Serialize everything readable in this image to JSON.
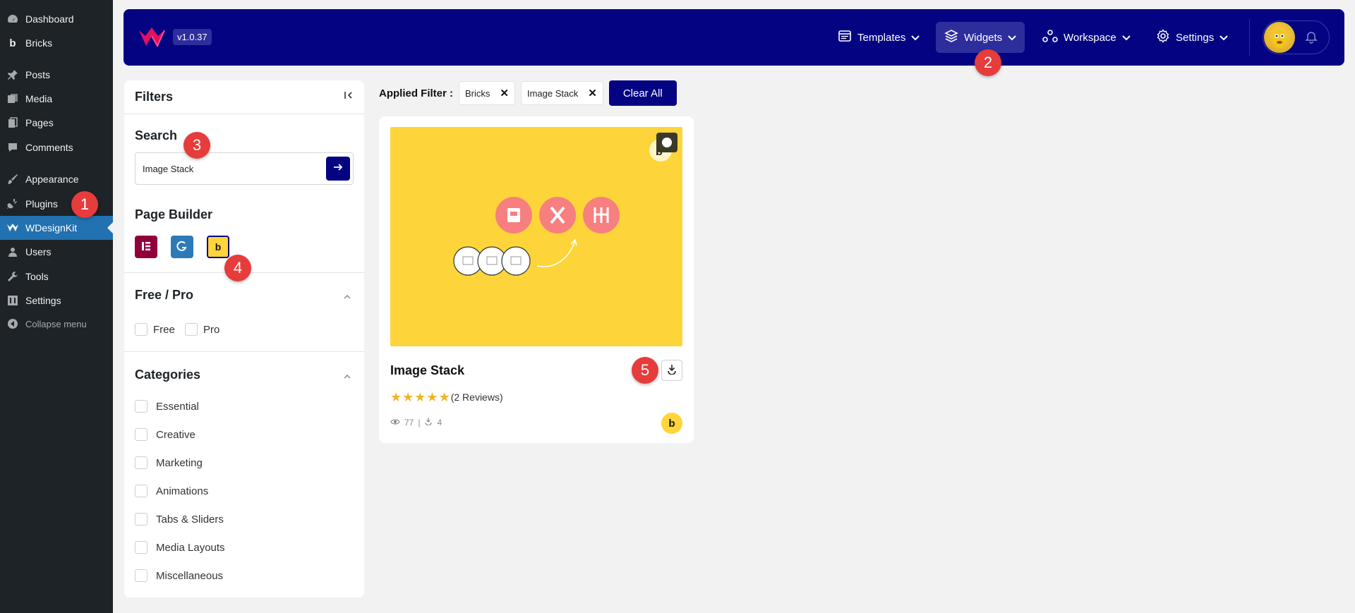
{
  "wp_menu": [
    {
      "label": "Dashboard",
      "icon": "dashboard-icon"
    },
    {
      "label": "Bricks",
      "icon": "bricks-icon"
    },
    {
      "label": "Posts",
      "icon": "pin-icon"
    },
    {
      "label": "Media",
      "icon": "media-icon"
    },
    {
      "label": "Pages",
      "icon": "pages-icon"
    },
    {
      "label": "Comments",
      "icon": "comments-icon"
    },
    {
      "label": "Appearance",
      "icon": "brush-icon"
    },
    {
      "label": "Plugins",
      "icon": "plug-icon"
    },
    {
      "label": "WDesignKit",
      "icon": "wdesignkit-icon"
    },
    {
      "label": "Users",
      "icon": "users-icon"
    },
    {
      "label": "Tools",
      "icon": "wrench-icon"
    },
    {
      "label": "Settings",
      "icon": "settings-icon"
    },
    {
      "label": "Collapse menu",
      "icon": "collapse-icon"
    }
  ],
  "header": {
    "version": "v1.0.37",
    "nav": {
      "templates": "Templates",
      "widgets": "Widgets",
      "workspace": "Workspace",
      "settings": "Settings"
    }
  },
  "filters": {
    "title": "Filters",
    "search_title": "Search",
    "search_value": "Image Stack",
    "page_builder_title": "Page Builder",
    "builders": [
      "Elementor",
      "Gutenberg",
      "Bricks"
    ],
    "free_pro_title": "Free / Pro",
    "free_label": "Free",
    "pro_label": "Pro",
    "categories_title": "Categories",
    "categories": [
      "Essential",
      "Creative",
      "Marketing",
      "Animations",
      "Tabs & Sliders",
      "Media Layouts",
      "Miscellaneous"
    ]
  },
  "applied": {
    "label": "Applied Filter :",
    "chips": [
      "Bricks",
      "Image Stack"
    ],
    "clear_label": "Clear All"
  },
  "card": {
    "title": "Image Stack",
    "rating": 5,
    "reviews": "(2 Reviews)",
    "views": "77",
    "downloads": "4",
    "builder_badge": "b"
  },
  "steps": [
    "1",
    "2",
    "3",
    "4",
    "5"
  ],
  "colors": {
    "brand": "#040483",
    "wp_active": "#2271b1",
    "step_badge": "#e63c3c",
    "thumb_bg": "#fdd53a",
    "star": "#f0b428"
  }
}
